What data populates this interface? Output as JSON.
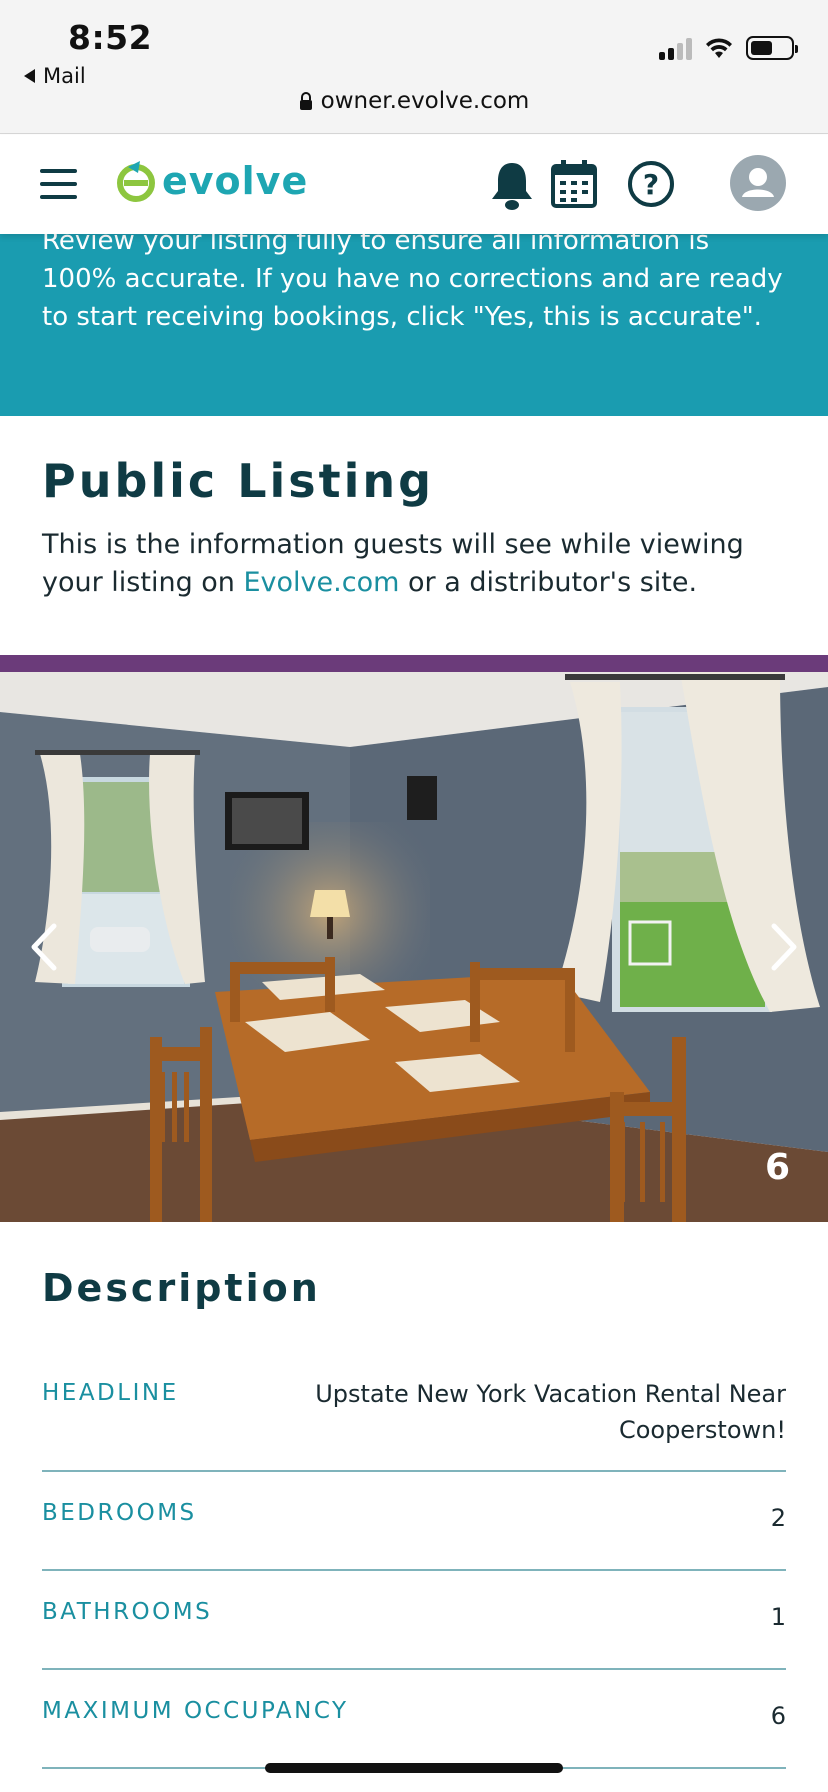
{
  "status_bar": {
    "time": "8:52",
    "back_app": "Mail",
    "url": "owner.evolve.com"
  },
  "header": {
    "logo_text": "evolve",
    "icons": [
      "menu-icon",
      "bell-icon",
      "calendar-icon",
      "help-icon",
      "avatar-icon"
    ],
    "accent_color": "#1ea6b2",
    "logo_green": "#8dc63f"
  },
  "banner": {
    "text": "Review your listing fully to ensure all information is 100% accurate. If you have no corrections and are ready to start receiving bookings, click \"Yes, this is accurate\".",
    "color": "#1a9cb0"
  },
  "public_listing": {
    "title": "Public Listing",
    "subtitle_before": "This is the information guests will see while viewing your listing on ",
    "subtitle_link": "Evolve.com",
    "subtitle_after": " or a distributor's site."
  },
  "photo": {
    "count": "6",
    "prev_icon": "chevron-left-icon",
    "next_icon": "chevron-right-icon"
  },
  "description": {
    "title": "Description",
    "rows": [
      {
        "label": "HEADLINE",
        "value": "Upstate New York Vacation Rental Near Cooperstown!"
      },
      {
        "label": "BEDROOMS",
        "value": "2"
      },
      {
        "label": "BATHROOMS",
        "value": "1"
      },
      {
        "label": "MAXIMUM OCCUPANCY",
        "value": "6"
      }
    ]
  }
}
